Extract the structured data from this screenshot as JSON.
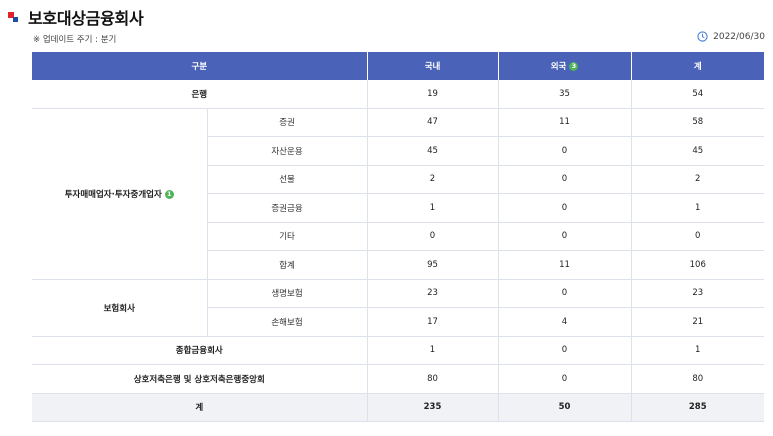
{
  "page": {
    "title": "보호대상금융회사",
    "note": "※ 업데이트 주기 : 분기",
    "date": "2022/06/30"
  },
  "table": {
    "headers": {
      "category": "구분",
      "domestic": "국내",
      "foreign": "외국",
      "foreign_badge": "3",
      "total": "계"
    },
    "rows": {
      "bank": {
        "label": "은행",
        "domestic": "19",
        "foreign": "35",
        "total": "54"
      },
      "investment": {
        "label": "투자매매업자·투자중개업자",
        "badge": "1",
        "items": [
          {
            "label": "증권",
            "domestic": "47",
            "foreign": "11",
            "total": "58"
          },
          {
            "label": "자산운용",
            "domestic": "45",
            "foreign": "0",
            "total": "45"
          },
          {
            "label": "선물",
            "domestic": "2",
            "foreign": "0",
            "total": "2"
          },
          {
            "label": "증권금융",
            "domestic": "1",
            "foreign": "0",
            "total": "1"
          },
          {
            "label": "기타",
            "domestic": "0",
            "foreign": "0",
            "total": "0"
          },
          {
            "label": "합계",
            "domestic": "95",
            "foreign": "11",
            "total": "106"
          }
        ]
      },
      "insurance": {
        "label": "보험회사",
        "items": [
          {
            "label": "생명보험",
            "domestic": "23",
            "foreign": "0",
            "total": "23"
          },
          {
            "label": "손해보험",
            "domestic": "17",
            "foreign": "4",
            "total": "21"
          }
        ]
      },
      "general": {
        "label": "종합금융회사",
        "domestic": "1",
        "foreign": "0",
        "total": "1"
      },
      "savings": {
        "label": "상호저축은행 및 상호저축은행중앙회",
        "domestic": "80",
        "foreign": "0",
        "total": "80"
      },
      "grand_total": {
        "label": "계",
        "domestic": "235",
        "foreign": "50",
        "total": "285"
      }
    }
  }
}
